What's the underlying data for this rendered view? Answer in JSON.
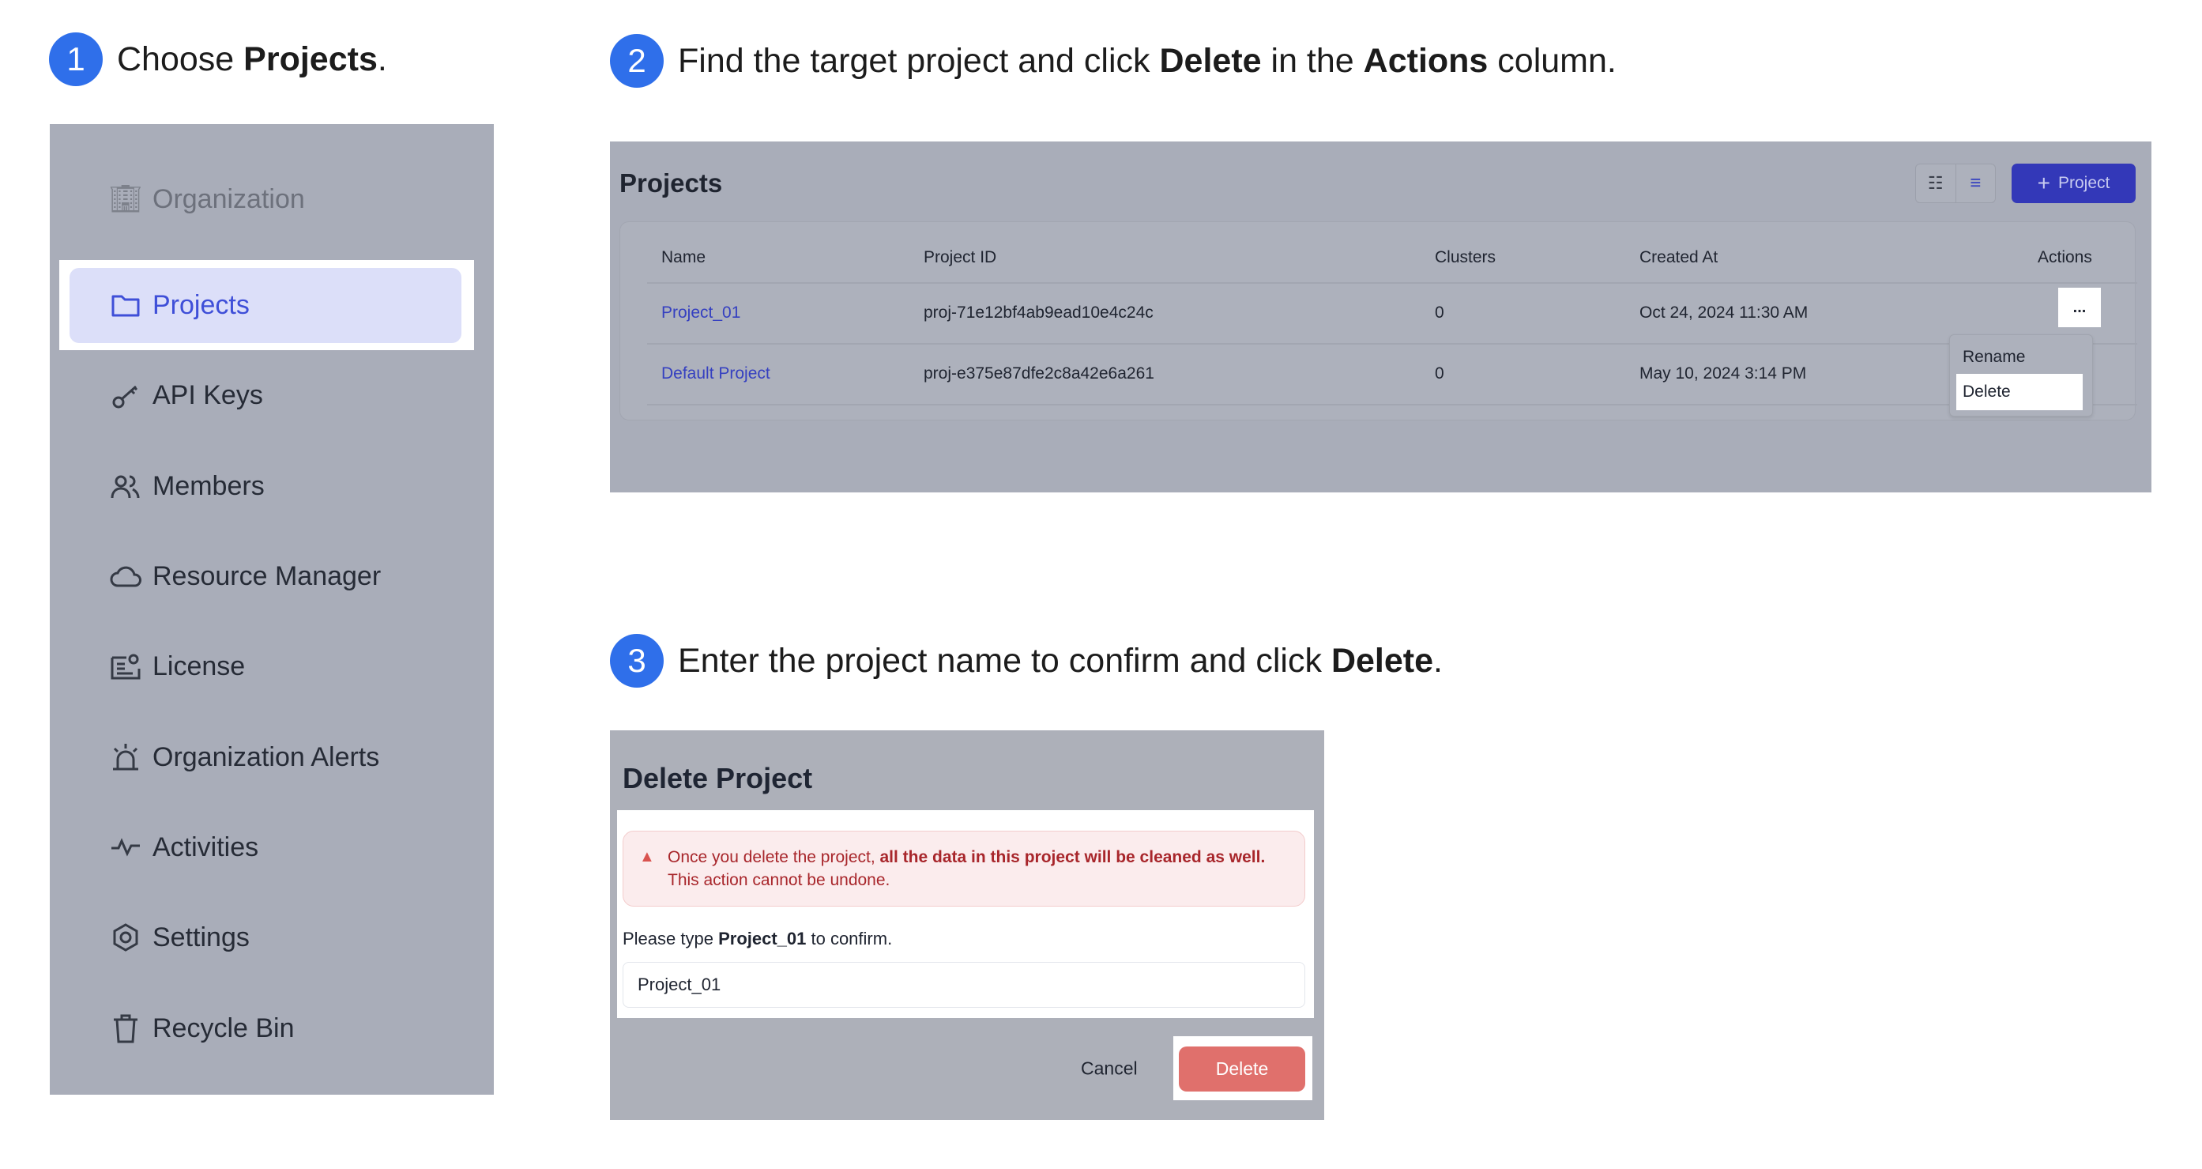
{
  "steps": [
    {
      "number": "1",
      "pre": "Choose ",
      "bold": "Projects",
      "post": "."
    },
    {
      "number": "2",
      "pre": "Find the target project and click ",
      "bold": "Delete",
      "mid": " in the ",
      "bold2": "Actions",
      "post": " column."
    },
    {
      "number": "3",
      "pre": "Enter the project name to confirm and click ",
      "bold": "Delete",
      "post": "."
    }
  ],
  "sidebar": {
    "items": [
      {
        "label": "Organization",
        "icon": "building-icon"
      },
      {
        "label": "Projects",
        "icon": "folder-icon",
        "active": true
      },
      {
        "label": "API Keys",
        "icon": "key-icon"
      },
      {
        "label": "Members",
        "icon": "users-icon"
      },
      {
        "label": "Resource Manager",
        "icon": "cloud-icon"
      },
      {
        "label": "License",
        "icon": "license-icon"
      },
      {
        "label": "Organization Alerts",
        "icon": "alarm-icon"
      },
      {
        "label": "Activities",
        "icon": "activity-icon"
      },
      {
        "label": "Settings",
        "icon": "gear-icon"
      },
      {
        "label": "Recycle Bin",
        "icon": "trash-icon"
      }
    ]
  },
  "projects": {
    "title": "Projects",
    "add_button": "Project",
    "columns": [
      "Name",
      "Project ID",
      "Clusters",
      "Created At",
      "Actions"
    ],
    "rows": [
      {
        "name": "Project_01",
        "id": "proj-71e12bf4ab9ead10e4c24c",
        "clusters": "0",
        "created": "Oct 24, 2024 11:30 AM"
      },
      {
        "name": "Default Project",
        "id": "proj-e375e87dfe2c8a42e6a261",
        "clusters": "0",
        "created": "May 10, 2024 3:14 PM"
      }
    ],
    "actions_menu": {
      "trigger": "...",
      "items": [
        "Rename",
        "Delete"
      ]
    }
  },
  "dialog": {
    "title": "Delete Project",
    "warning_pre": "Once you delete the project, ",
    "warning_bold": "all the data in this project will be cleaned as well.",
    "warning_line2": "This action cannot be undone.",
    "confirm_pre": "Please type ",
    "confirm_name": "Project_01",
    "confirm_post": " to confirm.",
    "input_value": "Project_01",
    "cancel": "Cancel",
    "delete": "Delete"
  },
  "colors": {
    "accent": "#2f6fea",
    "primary_button": "#3338b8",
    "danger": "#e0706c",
    "link": "#3540c0"
  }
}
